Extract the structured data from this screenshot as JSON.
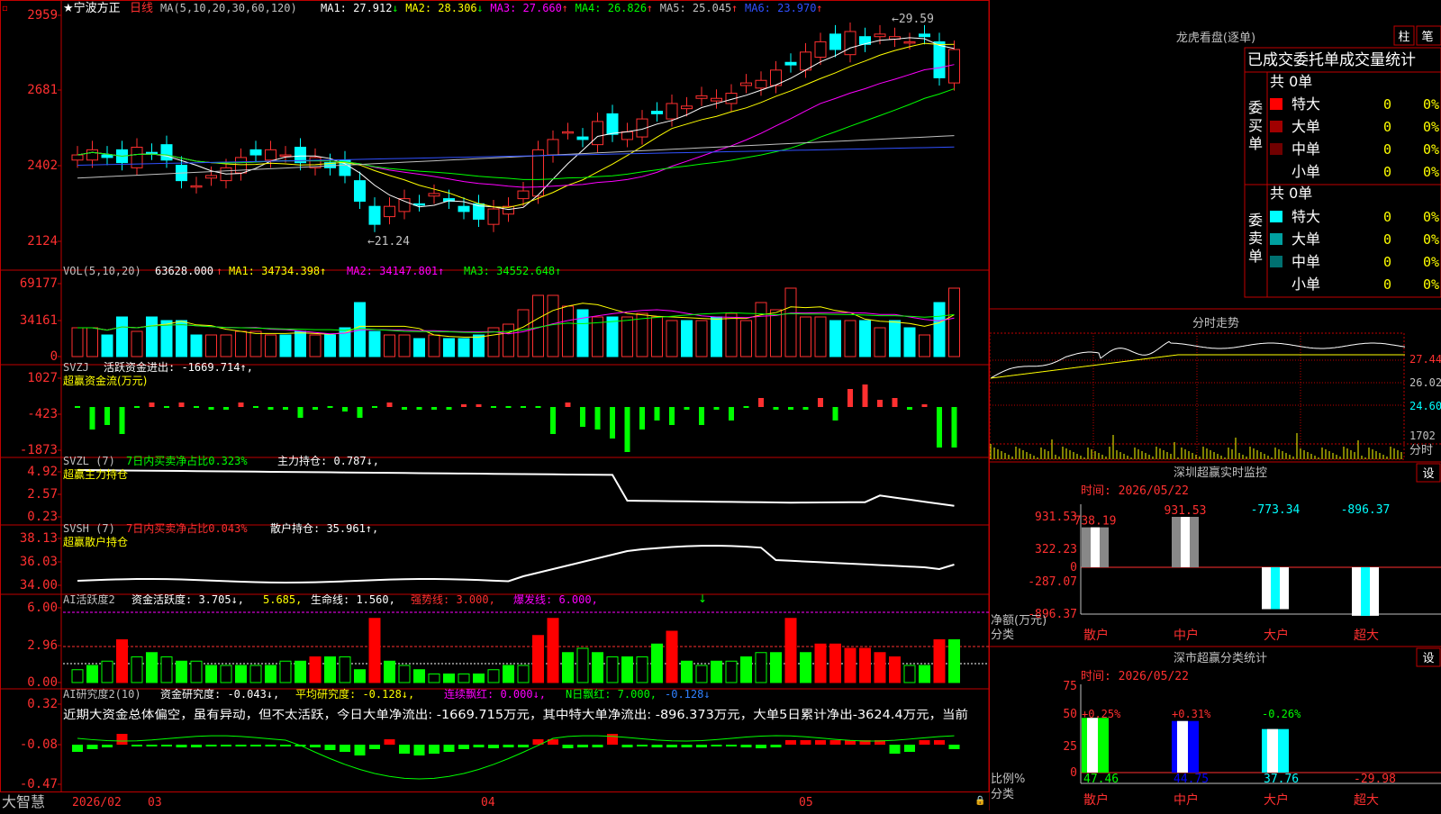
{
  "stock": {
    "name": "★宁波方正",
    "period": "日线"
  },
  "main_chart": {
    "ma_header": "MA(5,10,20,30,60,120)",
    "ma_values": [
      {
        "label": "MA1:",
        "value": "27.912",
        "arrow": "↓",
        "color": "#ffffff"
      },
      {
        "label": "MA2:",
        "value": "28.306",
        "arrow": "↓",
        "color": "#ffff00"
      },
      {
        "label": "MA3:",
        "value": "27.660",
        "arrow": "↑",
        "color": "#ff00ff"
      },
      {
        "label": "MA4:",
        "value": "26.826",
        "arrow": "↑",
        "color": "#00ff00"
      },
      {
        "label": "MA5:",
        "value": "25.045",
        "arrow": "↑",
        "color": "#c0c0c0"
      },
      {
        "label": "MA6:",
        "value": "23.970",
        "arrow": "↑",
        "color": "#3050ff"
      }
    ],
    "y_ticks": [
      "2959",
      "2681",
      "2402",
      "2124"
    ],
    "high_label": "29.59",
    "low_label": "21.24"
  },
  "vol_panel": {
    "header": "VOL(5,10,20)",
    "vol": "63628.000",
    "arrow": "↑",
    "ma1": "MA1: 34734.398↑",
    "ma2": "MA2: 34147.801↑",
    "ma3": "MA3: 34552.648↑",
    "y_ticks": [
      "69177",
      "34161",
      "0"
    ]
  },
  "svzj_panel": {
    "header": "SVZJ",
    "line1": "活跃资金进出: -1669.714↑,",
    "line2": "超赢资金流(万元)",
    "y_ticks": [
      "1027",
      "-423",
      "-1873"
    ]
  },
  "svzl_panel": {
    "header": "SVZL (7)",
    "ratio": "7日内买卖净占比0.323%",
    "hold": "主力持仓: 0.787↓,",
    "sub": "超赢主力持仓",
    "y_ticks": [
      "4.92",
      "2.57",
      "0.23"
    ]
  },
  "svsh_panel": {
    "header": "SVSH (7)",
    "ratio": "7日内买卖净占比0.043%",
    "hold": "散户持仓: 35.961↑,",
    "sub": "超赢散户持仓",
    "y_ticks": [
      "38.13",
      "36.03",
      "34.00"
    ]
  },
  "ai_active_panel": {
    "header": "AI活跃度2",
    "active": "资金活跃度: 3.705↓,",
    "v2": "5.685,",
    "life": "生命线: 1.560,",
    "strong": "强势线: 3.000,",
    "burst": "爆发线: 6.000,",
    "y_ticks": [
      "6.00",
      "2.96",
      "0.00"
    ]
  },
  "ai_research_panel": {
    "header": "AI研究度2(10)",
    "research": "资金研究度: -0.043↓,",
    "avg": "平均研究度: -0.128↓,",
    "red": "连续飘红: 0.000↓,",
    "nred": "N日飘红: 7.000,",
    "nred2": "-0.128↓",
    "comment": "近期大资金总体偏空，虽有异动，但不太活跃，今日大单净流出: -1669.715万元，其中特大单净流出: -896.373万元，大单5日累计净出-3624.4万元，当前",
    "y_ticks": [
      "0.32",
      "-0.08",
      "-0.47"
    ]
  },
  "bottom_bar": {
    "brand": "大智慧",
    "dates": [
      "2026/02",
      "03",
      "04",
      "05"
    ]
  },
  "dragon": {
    "title": "龙虎看盘(逐单)",
    "btn_bar": "柱",
    "btn_pen": "笔",
    "tabs": "已成交委托单成交量统计",
    "buy_side": "委买单",
    "sell_side": "委卖单",
    "buy_total": "共 0单",
    "sell_total": "共 0单",
    "buy_rows": [
      {
        "label": "特大",
        "count": "0",
        "pct": "0%",
        "color": "#ff0000"
      },
      {
        "label": "大单",
        "count": "0",
        "pct": "0%",
        "color": "#a00000"
      },
      {
        "label": "中单",
        "count": "0",
        "pct": "0%",
        "color": "#700000"
      },
      {
        "label": "小单",
        "count": "0",
        "pct": "0%",
        "color": ""
      }
    ],
    "sell_rows": [
      {
        "label": "特大",
        "count": "0",
        "pct": "0%",
        "color": "#00ffff"
      },
      {
        "label": "大单",
        "count": "0",
        "pct": "0%",
        "color": "#00a0a0"
      },
      {
        "label": "中单",
        "count": "0",
        "pct": "0%",
        "color": "#007070"
      },
      {
        "label": "小单",
        "count": "0",
        "pct": "0%",
        "color": ""
      }
    ]
  },
  "intraday": {
    "title": "分时走势",
    "prices": [
      "27.44",
      "26.02",
      "24.60"
    ],
    "vol_label": "1702",
    "unit": "分时"
  },
  "sz_monitor": {
    "title": "深圳超赢实时监控",
    "btn": "设",
    "time": "时间: 2026/05/22",
    "y_ticks": [
      "931.53",
      "322.23",
      "0",
      "-287.07",
      "-896.37"
    ],
    "ylabel1": "净额(万元)",
    "ylabel2": "分类",
    "categories": [
      "散户",
      "中户",
      "大户",
      "超大"
    ],
    "values": [
      738.19,
      931.53,
      -773.34,
      -896.37
    ],
    "value_labels": [
      "738.19",
      "931.53",
      "-773.34",
      "-896.37"
    ]
  },
  "sz_stats": {
    "title": "深市超赢分类统计",
    "btn": "设",
    "time": "时间: 2026/05/22",
    "y_ticks": [
      "75",
      "50",
      "25",
      "0"
    ],
    "ylabel1": "比例%",
    "ylabel2": "分类",
    "categories": [
      "散户",
      "中户",
      "大户",
      "超大"
    ],
    "top_labels": [
      "+0.25%",
      "+0.31%",
      "-0.26%",
      ""
    ],
    "values": [
      47.46,
      44.75,
      37.76,
      -29.98
    ],
    "value_labels": [
      "47.46",
      "44.75",
      "37.76",
      "-29.98"
    ]
  },
  "colors": {
    "up": "#ff3030",
    "down": "#00ffff",
    "grid": "#c00000",
    "text": "#c0c0c0",
    "label": "#ff4040"
  }
}
